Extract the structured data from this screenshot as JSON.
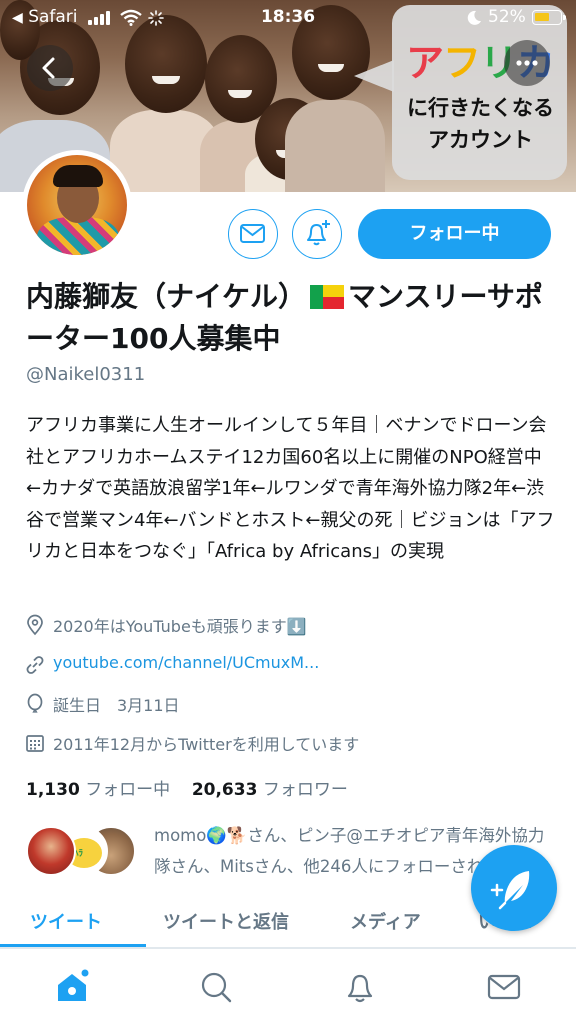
{
  "status_bar": {
    "carrier": "Safari",
    "time": "18:36",
    "battery": "52%"
  },
  "banner": {
    "title_chars": [
      "ア",
      "フ",
      "リ",
      "カ"
    ],
    "line1": "に行きたくなる",
    "line2": "アカウント"
  },
  "header": {
    "follow_label": "フォロー中"
  },
  "profile": {
    "name_part1": "内藤獅友（ナイケル）",
    "name_part2": "マンスリーサポーター100人募集中",
    "handle": "@Naikel0311",
    "bio": "アフリカ事業に人生オールインして５年目｜ベナンでドローン会社とアフリカホームステイ12カ国60名以上に開催のNPO経営中←カナダで英語放浪留学1年←ルワンダで青年海外協力隊2年←渋谷で営業マン4年←バンドとホスト←親父の死｜ビジョンは「アフリカと日本をつなぐ」「Africa by Africans」の実現",
    "location": "2020年はYouTubeも頑張ります⬇️",
    "link": "youtube.com/channel/UCmuxM...",
    "birthday": "誕生日　3月11日",
    "joined": "2011年12月からTwitterを利用しています",
    "following_count": "1,130",
    "following_label": "フォロー中",
    "followers_count": "20,633",
    "followers_label": "フォロワー",
    "followed_by": "momo🌍🐕さん、ピン子@エチオピア青年海外協力隊さん、Mitsさん、他246人にフォローされています"
  },
  "tabs": [
    {
      "label": "ツイート",
      "active": true
    },
    {
      "label": "ツイートと返信",
      "active": false
    },
    {
      "label": "メディア",
      "active": false
    },
    {
      "label": "いいね",
      "active": false
    }
  ],
  "icons": {
    "back": "chevron-left-icon",
    "more": "more-horizontal-icon",
    "mail": "mail-icon",
    "bell": "bell-plus-icon",
    "location": "location-pin-icon",
    "link": "link-icon",
    "birthday": "balloon-icon",
    "calendar": "calendar-icon",
    "compose": "feather-icon",
    "home": "home-icon",
    "search": "search-icon",
    "notifications": "bell-icon",
    "messages": "mail-icon"
  },
  "colors": {
    "accent": "#1da1f2",
    "secondary_text": "#657786",
    "link": "#1b95e0"
  }
}
